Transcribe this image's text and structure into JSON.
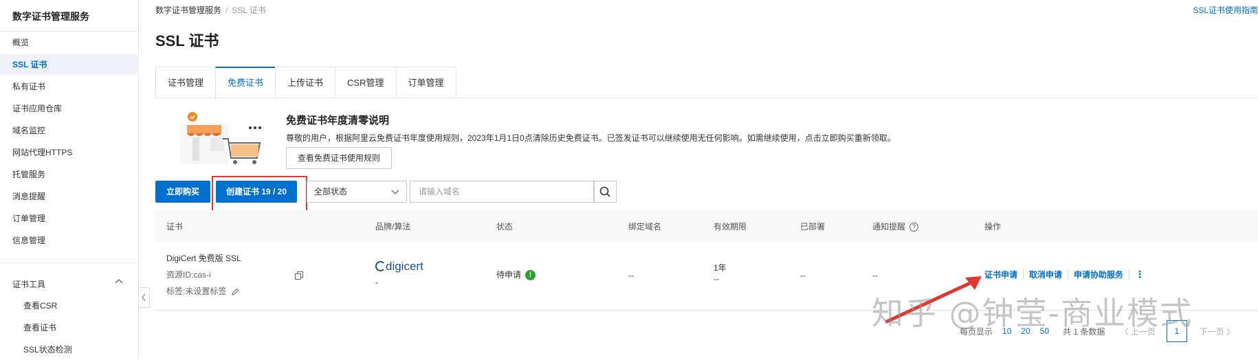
{
  "sidebar": {
    "title": "数字证书管理服务",
    "items": [
      "概览",
      "SSL 证书",
      "私有证书",
      "证书应用仓库",
      "域名监控",
      "网站代理HTTPS",
      "托管服务",
      "消息提醒",
      "订单管理",
      "信息管理"
    ],
    "group_title": "证书工具",
    "sub_items": [
      "查看CSR",
      "查看证书",
      "SSL状态检测"
    ]
  },
  "breadcrumb": {
    "parent": "数字证书管理服务",
    "sep": "/",
    "current": "SSL 证书"
  },
  "guide_link": "SSL证书使用指南",
  "page_title": "SSL 证书",
  "tabs": [
    "证书管理",
    "免费证书",
    "上传证书",
    "CSR管理",
    "订单管理"
  ],
  "notice": {
    "title": "免费证书年度清零说明",
    "text": "尊敬的用户，根据阿里云免费证书年度使用规则，2023年1月1日0点清除历史免费证书。已签发证书可以继续使用无任何影响。如需继续使用，点击立即购买重新领取。",
    "button": "查看免费证书使用规则"
  },
  "toolbar": {
    "buy_label": "立即购买",
    "create_label": "创建证书 19 / 20",
    "status_value": "全部状态",
    "search_placeholder": "请输入域名"
  },
  "table": {
    "headers": [
      "证书",
      "品牌/算法",
      "状态",
      "绑定域名",
      "有效期限",
      "已部署",
      "通知提醒",
      "操作"
    ],
    "row": {
      "name": "DigiCert 免费版 SSL",
      "resource_id": "资源ID:cas-i",
      "tag": "标签:未设置标签",
      "brand": "digicert",
      "brand_algo": "-",
      "status": "待申请",
      "domain": "--",
      "validity": "1年",
      "validity_sub": "--",
      "deployed": "--",
      "notify": "--",
      "actions": [
        "证书申请",
        "取消申请",
        "申请协助服务"
      ]
    }
  },
  "pagination": {
    "page_size_label": "每页显示",
    "page_sizes": [
      "10",
      "20",
      "50"
    ],
    "total": "共 1 条数据",
    "prev": "〈 上一页",
    "current": "1",
    "next": "下一页 〉"
  },
  "watermark": "知乎 @钟莹-商业模式",
  "colors": {
    "accent": "#0070cc",
    "highlight_box": "#e0382e",
    "success": "#2ca02c"
  }
}
